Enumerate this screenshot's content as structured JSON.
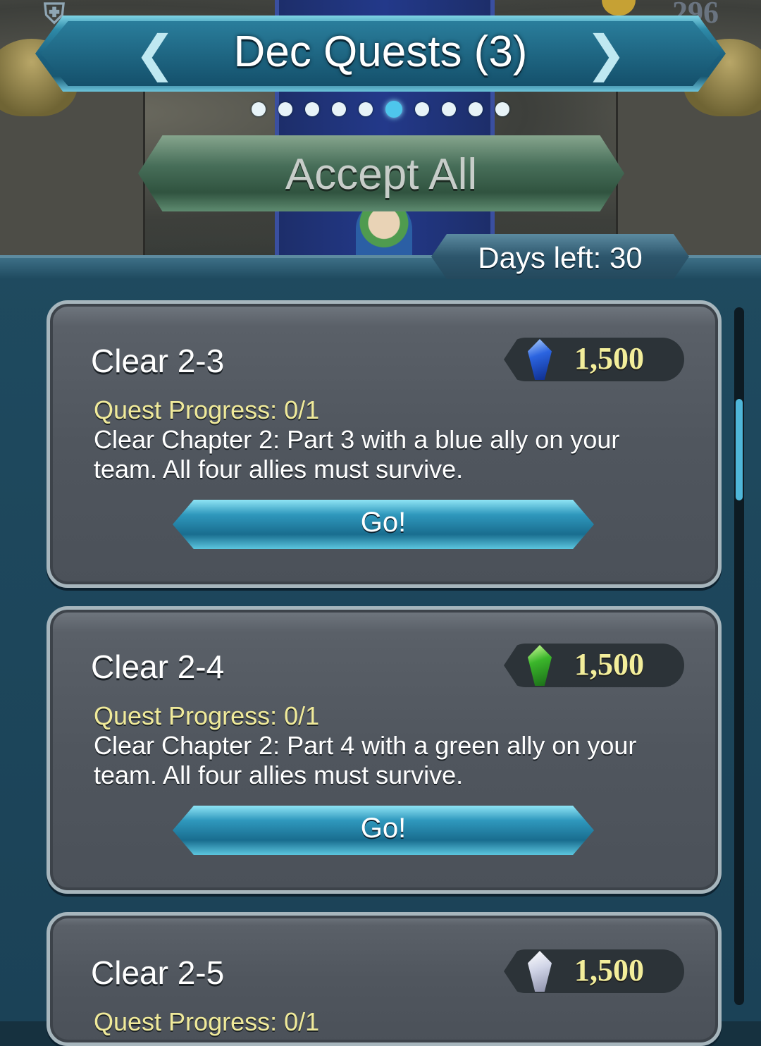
{
  "header": {
    "orb_count": "296",
    "title": "Dec Quests (3)"
  },
  "pager": {
    "total": 10,
    "active_index": 5
  },
  "actions": {
    "accept_all_label": "Accept All"
  },
  "status": {
    "days_left": "Days left: 30"
  },
  "quests": [
    {
      "title": "Clear 2-3",
      "reward_icon": "blue-orb-icon",
      "reward_value": "1,500",
      "progress": "Quest Progress: 0/1",
      "description": "Clear Chapter 2: Part 3 with a blue ally on your team. All four allies must survive.",
      "button_label": "Go!"
    },
    {
      "title": "Clear 2-4",
      "reward_icon": "green-orb-icon",
      "reward_value": "1,500",
      "progress": "Quest Progress: 0/1",
      "description": "Clear Chapter 2: Part 4 with a green ally on your team. All four allies must survive.",
      "button_label": "Go!"
    },
    {
      "title": "Clear 2-5",
      "reward_icon": "colorless-orb-icon",
      "reward_value": "1,500",
      "progress": "Quest Progress: 0/1"
    }
  ],
  "colors": {
    "accent": "#4ec6ec",
    "reward_text": "#f3ee9b",
    "progress_text": "#f0ea9a"
  }
}
